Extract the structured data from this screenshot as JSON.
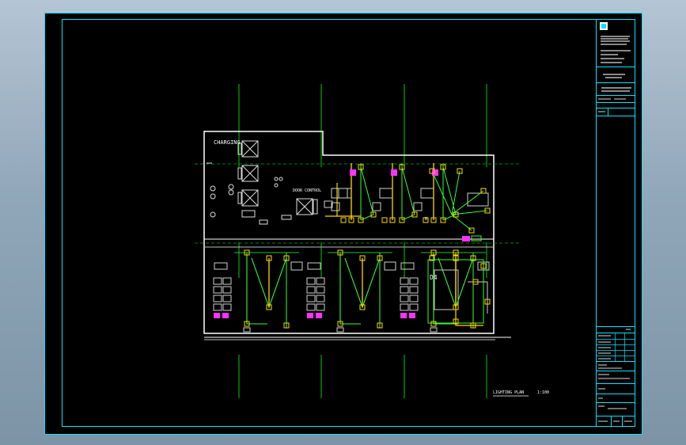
{
  "app": {
    "title": "",
    "viewer": "CAD drawing preview"
  },
  "drawing": {
    "top_left_label": "CHARGING",
    "corridor_label": "DOOR CONTROL",
    "plan_caption": "LIGHTING PLAN",
    "plan_scale": "1:100",
    "room_tag": "D4",
    "upper_room_tag": "B",
    "title_block": {
      "company_lines": [
        "",
        "",
        "",
        ""
      ],
      "project_label": "",
      "drawing_name": "",
      "sheet_no": "",
      "revision_label": ""
    }
  },
  "colors": {
    "sheet_background": "#000000",
    "outer_frame": "#00e5ff",
    "grid_lines": "#00cc00",
    "walls": "#ffffff",
    "circuits": "#33ff33",
    "fixtures": "#ffd700",
    "highlights": "#ff33ff",
    "equipment": "#c8c8c8"
  }
}
